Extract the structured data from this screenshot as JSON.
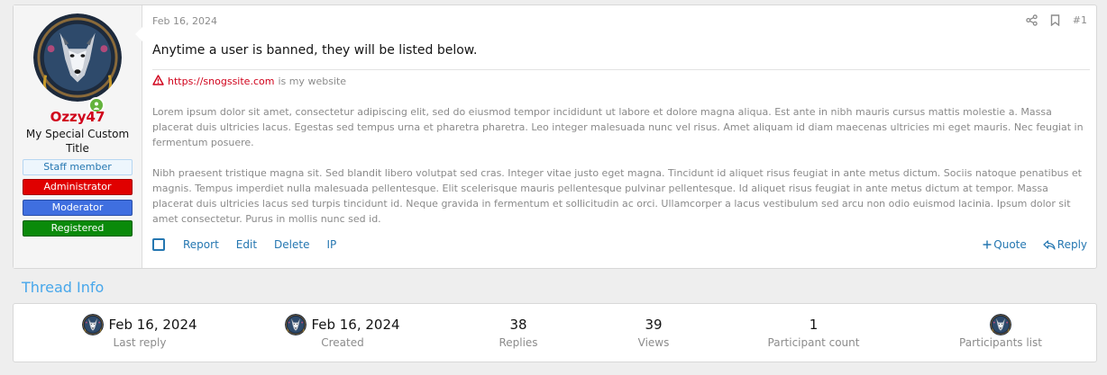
{
  "post": {
    "user": {
      "name": "Ozzy47",
      "title": "My Special Custom Title",
      "banners": [
        "Staff member",
        "Administrator",
        "Moderator",
        "Registered"
      ]
    },
    "date": "Feb 16, 2024",
    "number": "#1",
    "message": "Anytime a user is banned, they will be listed below.",
    "signature": {
      "link": "https://snogssite.com",
      "text": "is my website"
    },
    "paragraphs": [
      "Lorem ipsum dolor sit amet, consectetur adipiscing elit, sed do eiusmod tempor incididunt ut labore et dolore magna aliqua. Est ante in nibh mauris cursus mattis molestie a. Massa placerat duis ultricies lacus. Egestas sed tempus urna et pharetra pharetra. Leo integer malesuada nunc vel risus. Amet aliquam id diam maecenas ultricies mi eget mauris. Nec feugiat in fermentum posuere.",
      "Nibh praesent tristique magna sit. Sed blandit libero volutpat sed cras. Integer vitae justo eget magna. Tincidunt id aliquet risus feugiat in ante metus dictum. Sociis natoque penatibus et magnis. Tempus imperdiet nulla malesuada pellentesque. Elit scelerisque mauris pellentesque pulvinar pellentesque. Id aliquet risus feugiat in ante metus dictum at tempor. Massa placerat duis ultricies lacus sed turpis tincidunt id. Neque gravida in fermentum et sollicitudin ac orci. Ullamcorper a lacus vestibulum sed arcu non odio euismod lacinia. Ipsum dolor sit amet consectetur. Purus in mollis nunc sed id."
    ],
    "actions": [
      "Report",
      "Edit",
      "Delete",
      "IP"
    ],
    "quote_label": "Quote",
    "reply_label": "Reply",
    "icons": [
      "share-icon",
      "bookmark-icon",
      "warning-icon",
      "plus-icon",
      "reply-icon"
    ]
  },
  "thread_info": {
    "title": "Thread Info",
    "last_reply": {
      "value": "Feb 16, 2024",
      "label": "Last reply"
    },
    "created": {
      "value": "Feb 16, 2024",
      "label": "Created"
    },
    "replies": {
      "value": "38",
      "label": "Replies"
    },
    "views": {
      "value": "39",
      "label": "Views"
    },
    "participant_count": {
      "value": "1",
      "label": "Participant count"
    },
    "participants": {
      "label": "Participants list"
    }
  },
  "colors": {
    "accent": "#2577b1",
    "username": "#d0021b",
    "section_title": "#47a7eb"
  }
}
